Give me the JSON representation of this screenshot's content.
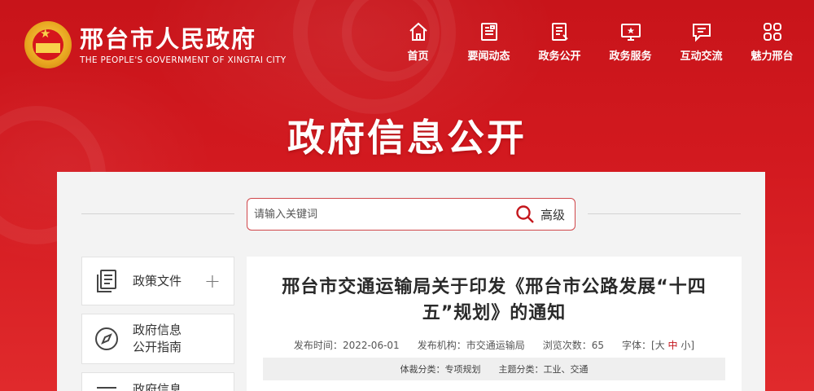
{
  "header": {
    "site_title_cn": "邢台市人民政府",
    "site_title_en": "THE PEOPLE'S GOVERNMENT OF XINGTAI CITY"
  },
  "nav": {
    "items": [
      {
        "label": "首页",
        "icon": "home-icon"
      },
      {
        "label": "要闻动态",
        "icon": "news-icon"
      },
      {
        "label": "政务公开",
        "icon": "document-icon"
      },
      {
        "label": "政务服务",
        "icon": "monitor-star-icon"
      },
      {
        "label": "互动交流",
        "icon": "chat-icon"
      },
      {
        "label": "魅力邢台",
        "icon": "grid-icon"
      }
    ]
  },
  "banner": {
    "title": "政府信息公开"
  },
  "search": {
    "placeholder": "请输入关键词",
    "advanced_label": "高级"
  },
  "sidebar": {
    "items": [
      {
        "label": "政策文件",
        "icon": "files-icon",
        "toggle": "+"
      },
      {
        "label_line1": "政府信息",
        "label_line2": "公开指南",
        "icon": "compass-icon"
      },
      {
        "label": "政府信息",
        "icon": "list-icon"
      }
    ]
  },
  "article": {
    "title": "邢台市交通运输局关于印发《邢台市公路发展“十四五”规划》的通知",
    "publish_time_label": "发布时间：",
    "publish_time": "2022-06-01",
    "agency_label": "发布机构：",
    "agency": "市交通运输局",
    "views_label": "浏览次数：",
    "views": "65",
    "font_label": "字体：",
    "font_open": "[大",
    "font_mid": "中",
    "font_close": "小]",
    "genre_label": "体裁分类：",
    "genre": "专项规划",
    "topic_label": "主题分类：",
    "topic": "工业、交通"
  },
  "colors": {
    "brand_red": "#c4161c",
    "panel_bg": "#f3f3f3",
    "gold": "#f8d24b"
  }
}
